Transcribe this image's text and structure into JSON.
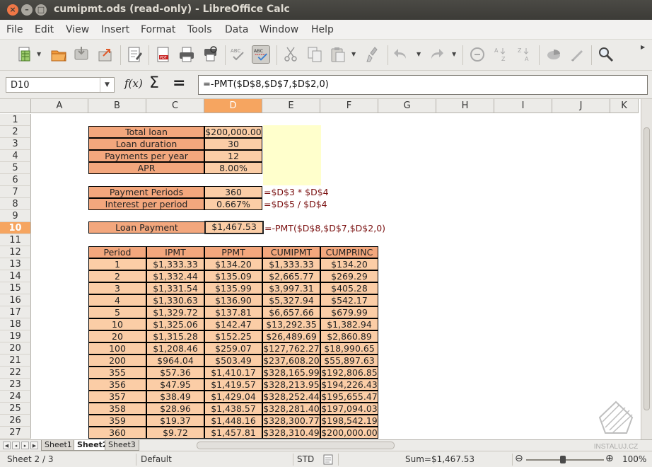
{
  "window": {
    "title": "cumipmt.ods (read-only) - LibreOffice Calc"
  },
  "menu": [
    "File",
    "Edit",
    "View",
    "Insert",
    "Format",
    "Tools",
    "Data",
    "Window",
    "Help"
  ],
  "formula_bar": {
    "name_box": "D10",
    "formula": "=-PMT($D$8,$D$7,$D$2,0)"
  },
  "columns": [
    "A",
    "B",
    "C",
    "D",
    "E",
    "F",
    "G",
    "H",
    "I",
    "J",
    "K"
  ],
  "active": {
    "column": "D",
    "row": "10"
  },
  "rows": [
    "1",
    "2",
    "3",
    "4",
    "5",
    "6",
    "7",
    "8",
    "9",
    "10",
    "11",
    "12",
    "13",
    "14",
    "15",
    "16",
    "17",
    "18",
    "19",
    "20",
    "21",
    "22",
    "23",
    "24",
    "25",
    "26",
    "27"
  ],
  "inputs": [
    {
      "label": "Total loan",
      "value": "$200,000.00"
    },
    {
      "label": "Loan duration",
      "value": "30"
    },
    {
      "label": "Payments per year",
      "value": "12"
    },
    {
      "label": "APR",
      "value": "8.00%"
    }
  ],
  "calc": [
    {
      "label": "Payment Periods",
      "value": "360",
      "note": "=$D$3 * $D$4"
    },
    {
      "label": "Interest per period",
      "value": "0.667%",
      "note": "=$D$5 / $D$4"
    }
  ],
  "payment": {
    "label": "Loan Payment",
    "value": "$1,467.53",
    "note": "=-PMT($D$8,$D$7,$D$2,0)"
  },
  "table": {
    "headers": [
      "Period",
      "IPMT",
      "PPMT",
      "CUMIPMT",
      "CUMPRINC"
    ],
    "rows": [
      [
        "1",
        "$1,333.33",
        "$134.20",
        "$1,333.33",
        "$134.20"
      ],
      [
        "2",
        "$1,332.44",
        "$135.09",
        "$2,665.77",
        "$269.29"
      ],
      [
        "3",
        "$1,331.54",
        "$135.99",
        "$3,997.31",
        "$405.28"
      ],
      [
        "4",
        "$1,330.63",
        "$136.90",
        "$5,327.94",
        "$542.17"
      ],
      [
        "5",
        "$1,329.72",
        "$137.81",
        "$6,657.66",
        "$679.99"
      ],
      [
        "10",
        "$1,325.06",
        "$142.47",
        "$13,292.35",
        "$1,382.94"
      ],
      [
        "20",
        "$1,315.28",
        "$152.25",
        "$26,489.69",
        "$2,860.89"
      ],
      [
        "100",
        "$1,208.46",
        "$259.07",
        "$127,762.27",
        "$18,990.65"
      ],
      [
        "200",
        "$964.04",
        "$503.49",
        "$237,608.20",
        "$55,897.63"
      ],
      [
        "355",
        "$57.36",
        "$1,410.17",
        "$328,165.99",
        "$192,806.85"
      ],
      [
        "356",
        "$47.95",
        "$1,419.57",
        "$328,213.95",
        "$194,226.43"
      ],
      [
        "357",
        "$38.49",
        "$1,429.04",
        "$328,252.44",
        "$195,655.47"
      ],
      [
        "358",
        "$28.96",
        "$1,438.57",
        "$328,281.40",
        "$197,094.03"
      ],
      [
        "359",
        "$19.37",
        "$1,448.16",
        "$328,300.77",
        "$198,542.19"
      ],
      [
        "360",
        "$9.72",
        "$1,457.81",
        "$328,310.49",
        "$200,000.00"
      ]
    ]
  },
  "sheets": [
    "Sheet1",
    "Sheet2",
    "Sheet3"
  ],
  "active_sheet": "Sheet2",
  "status": {
    "sheet": "Sheet 2 / 3",
    "style": "Default",
    "mode": "STD",
    "sum": "Sum=$1,467.53",
    "zoom": "100%"
  },
  "watermark": "INSTALUJ.CZ",
  "colors": {
    "header_fill": "#f3a77d",
    "value_fill": "#fbcda6",
    "highlight": "#ffffcc",
    "note_text": "#7a1010",
    "active_header": "#f6a560"
  }
}
